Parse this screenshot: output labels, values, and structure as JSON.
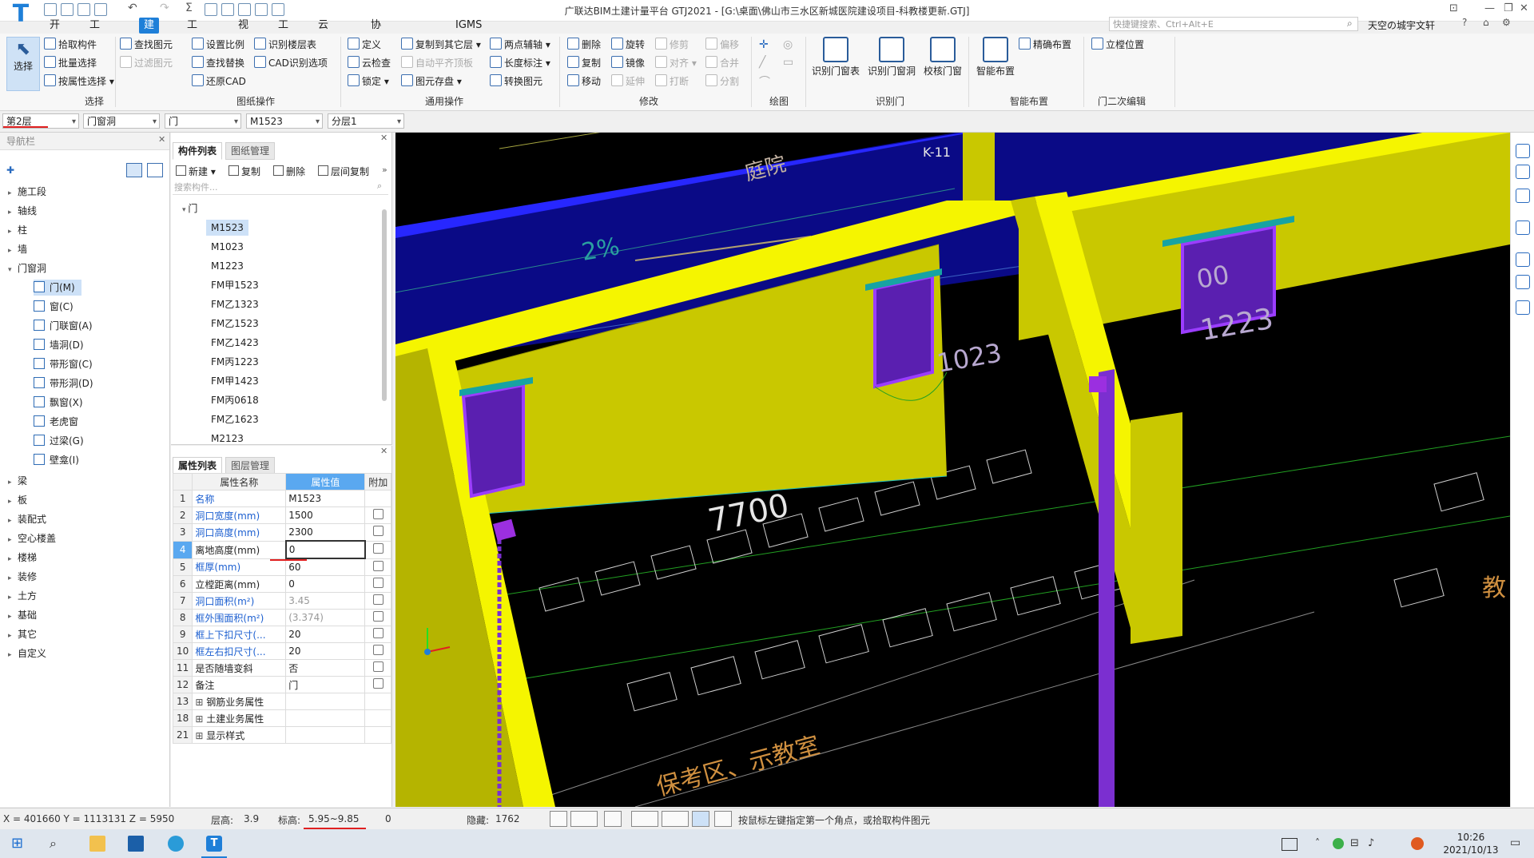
{
  "titlebar": {
    "title": "广联达BIM土建计量平台 GTJ2021 - [G:\\桌面\\佛山市三水区新城医院建设项目-科教楼更新.GTJ]"
  },
  "menu": {
    "items": [
      "开始",
      "工程设置",
      "建模",
      "工程量",
      "视图",
      "工具",
      "云应用",
      "协同建模(限免)",
      "IGMS"
    ],
    "active": "建模",
    "search_placeholder": "快捷键搜索、Ctrl+Alt+E",
    "user": "天空の城宇文轩"
  },
  "ribbon": {
    "select_big": "选择",
    "select_group": {
      "buttons": [
        "拾取构件",
        "批量选择",
        "按属性选择"
      ],
      "label": "选择"
    },
    "cad_group": {
      "buttons": [
        "查找图元",
        "过滤图元",
        "设置比例",
        "查找替换",
        "还原CAD",
        "识别楼层表",
        "CAD识别选项"
      ],
      "label": "图纸操作"
    },
    "general_group": {
      "buttons": [
        "定义",
        "云检查",
        "锁定",
        "复制到其它层",
        "自动平齐顶板",
        "图元存盘",
        "两点辅轴",
        "长度标注",
        "转换图元"
      ],
      "label": "通用操作"
    },
    "modify_group": {
      "buttons": [
        "删除",
        "复制",
        "移动",
        "旋转",
        "镜像",
        "延伸",
        "修剪",
        "对齐",
        "打断",
        "偏移",
        "合并",
        "分割"
      ],
      "label": "修改"
    },
    "draw_group": {
      "label": "绘图"
    },
    "identify_group": {
      "buttons": [
        "识别门窗表",
        "识别门窗洞",
        "校核门窗"
      ],
      "label": "识别门"
    },
    "smart_group": {
      "buttons": [
        "智能布置",
        "精确布置"
      ],
      "label": "智能布置"
    },
    "edit_group": {
      "buttons": [
        "立樘位置"
      ],
      "label": "门二次编辑"
    }
  },
  "selectors": {
    "floor": "第2层",
    "category": "门窗洞",
    "type": "门",
    "component": "M1523",
    "layer": "分层1"
  },
  "nav": {
    "header": "导航栏",
    "items": [
      "施工段",
      "轴线",
      "柱",
      "墙",
      "门窗洞"
    ],
    "sub_items": [
      "门(M)",
      "窗(C)",
      "门联窗(A)",
      "墙洞(D)",
      "带形窗(C)",
      "带形洞(D)",
      "飘窗(X)",
      "老虎窗",
      "过梁(G)",
      "壁龛(I)"
    ],
    "items_after": [
      "梁",
      "板",
      "装配式",
      "空心楼盖",
      "楼梯",
      "装修",
      "土方",
      "基础",
      "其它",
      "自定义"
    ]
  },
  "component_list": {
    "tabs": [
      "构件列表",
      "图纸管理"
    ],
    "toolbar": [
      "新建",
      "复制",
      "删除",
      "层间复制"
    ],
    "search_placeholder": "搜索构件...",
    "group": "门",
    "items": [
      "M1523",
      "M1023",
      "M1223",
      "FM甲1523",
      "FM乙1323",
      "FM乙1523",
      "FM乙1423",
      "FM丙1223",
      "FM甲1423",
      "FM丙0618",
      "FM乙1623",
      "M2123"
    ],
    "selected": "M1523"
  },
  "properties": {
    "tabs": [
      "属性列表",
      "图层管理"
    ],
    "headers": [
      "属性名称",
      "属性值",
      "附加"
    ],
    "rows": [
      {
        "num": "1",
        "name": "名称",
        "value": "M1523"
      },
      {
        "num": "2",
        "name": "洞口宽度(mm)",
        "value": "1500"
      },
      {
        "num": "3",
        "name": "洞口高度(mm)",
        "value": "2300"
      },
      {
        "num": "4",
        "name": "离地高度(mm)",
        "value": "0"
      },
      {
        "num": "5",
        "name": "框厚(mm)",
        "value": "60"
      },
      {
        "num": "6",
        "name": "立樘距离(mm)",
        "value": "0"
      },
      {
        "num": "7",
        "name": "洞口面积(m²)",
        "value": "3.45"
      },
      {
        "num": "8",
        "name": "框外围面积(m²)",
        "value": "(3.374)"
      },
      {
        "num": "9",
        "name": "框上下扣尺寸(...",
        "value": "20"
      },
      {
        "num": "10",
        "name": "框左右扣尺寸(...",
        "value": "20"
      },
      {
        "num": "11",
        "name": "是否随墙变斜",
        "value": "否"
      },
      {
        "num": "12",
        "name": "备注",
        "value": "门"
      },
      {
        "num": "13",
        "name": "钢筋业务属性",
        "value": ""
      },
      {
        "num": "18",
        "name": "土建业务属性",
        "value": ""
      },
      {
        "num": "21",
        "name": "显示样式",
        "value": ""
      }
    ]
  },
  "viewport": {
    "labels": [
      "K-11",
      "庭院",
      "2%",
      "7700",
      "1223",
      "1023",
      "00",
      "保考区、示教室",
      "教"
    ]
  },
  "status": {
    "coords": "X = 401660 Y = 1113131 Z = 5950",
    "floor_height_label": "层高:",
    "floor_height": "3.9",
    "elevation_label": "标高:",
    "elevation": "5.95~9.85",
    "count": "0",
    "hidden_label": "隐藏:",
    "hidden": "1762",
    "hint": "按鼠标左键指定第一个角点，或拾取构件图元"
  },
  "taskbar": {
    "time": "10:26",
    "date": "2021/10/13"
  },
  "colors": {
    "accent": "#1e7fd8",
    "wall_yellow": "#f5f500",
    "wall_shade": "#c9c800",
    "door_purple": "#7b2fd0",
    "slab_blue": "#0a0a90",
    "annotation_red": "#e02020"
  }
}
